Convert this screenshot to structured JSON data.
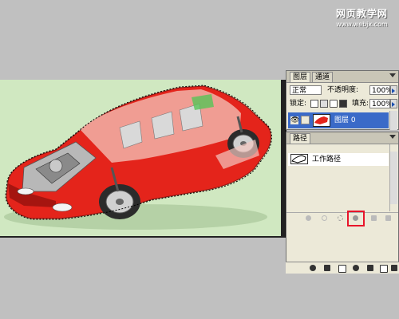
{
  "watermark": {
    "site_name": "网页教学网",
    "site_url": "www.webjx.com"
  },
  "layers_panel": {
    "tabs": [
      "图层",
      "通道"
    ],
    "blend_mode": "正常",
    "opacity_label": "不透明度:",
    "opacity_value": "100%",
    "lock_label": "锁定:",
    "fill_label": "填充:",
    "fill_value": "100%",
    "layers": [
      {
        "name": "图层 0",
        "visible": true
      }
    ]
  },
  "paths_panel": {
    "tab": "路径",
    "paths": [
      {
        "name": "工作路径"
      }
    ],
    "toolbar": [
      "fill-path",
      "stroke-path",
      "path-to-selection",
      "selection-to-path",
      "new-path",
      "delete-path"
    ],
    "highlighted_tool": "selection-to-path",
    "highlight_color": "#e8142a"
  },
  "bottom_toolbar": [
    "link-layers",
    "layer-style",
    "layer-mask",
    "new-group",
    "adjustment-layer",
    "new-layer",
    "delete-layer"
  ],
  "colors": {
    "car": "#e4241b",
    "canvas_bg": "#d5ecc7",
    "selected_layer": "#3a6ac8"
  }
}
